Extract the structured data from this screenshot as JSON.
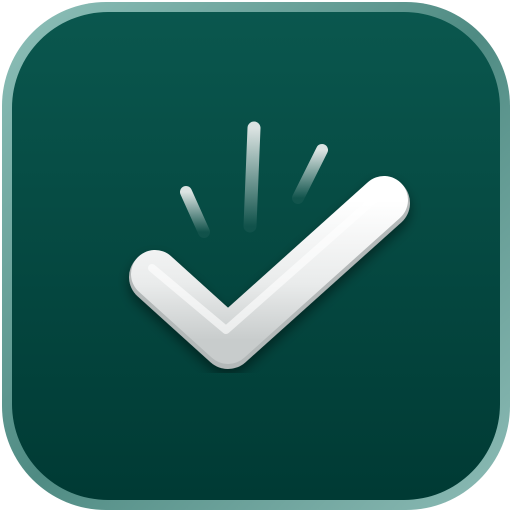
{
  "app_icon": {
    "name": "checkmark-app-icon",
    "icon": "checkmark-icon",
    "accent_marks_icon": "emphasis-lines-icon",
    "colors": {
      "background_top": "#0b5a50",
      "background_bottom": "#003b35",
      "frame_highlight": "#7fb3ac",
      "checkmark_light": "#f4f5f5",
      "checkmark_shadow": "#b9bdbd",
      "accent_marks": "#d6dbda"
    }
  }
}
